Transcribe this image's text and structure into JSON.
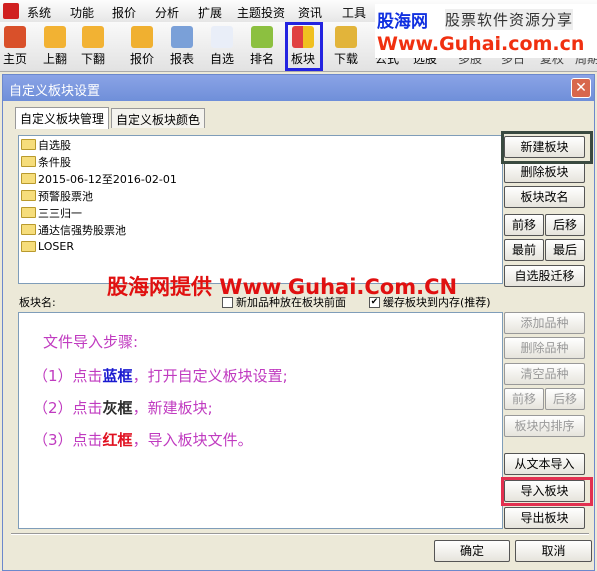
{
  "menubar": {
    "items": [
      "系统",
      "功能",
      "报价",
      "分析",
      "扩展",
      "主题投资",
      "资讯",
      "工具"
    ]
  },
  "toolbar": {
    "items": [
      {
        "label": "主页",
        "icon": "home-icon",
        "color": "#d9502a"
      },
      {
        "label": "上翻",
        "icon": "arrow-up-icon",
        "color": "#f2b233"
      },
      {
        "label": "下翻",
        "icon": "arrow-down-icon",
        "color": "#f2b233"
      },
      {
        "label": "报价",
        "icon": "yen-icon",
        "color": "#f0b030"
      },
      {
        "label": "报表",
        "icon": "report-icon",
        "color": "#7aa0d8"
      },
      {
        "label": "自选",
        "icon": "f6-icon",
        "color": "#e9eef8"
      },
      {
        "label": "排名",
        "icon": "rank-icon",
        "color": "#8cc040"
      },
      {
        "label": "板块",
        "icon": "blocks-icon",
        "color": "#e04040"
      },
      {
        "label": "下载",
        "icon": "download-icon",
        "color": "#e2b43a"
      },
      {
        "label": "公式",
        "icon": "",
        "color": ""
      },
      {
        "label": "选股",
        "icon": "",
        "color": ""
      },
      {
        "label": "多股",
        "icon": "",
        "color": ""
      },
      {
        "label": "多日",
        "icon": "",
        "color": ""
      },
      {
        "label": "复权",
        "icon": "",
        "color": ""
      },
      {
        "label": "周期",
        "icon": "",
        "color": ""
      }
    ]
  },
  "watermark_top": {
    "brand": "股海网",
    "tagline": "股票软件资源分享",
    "url": "Www.Guhai.com.cn"
  },
  "dialog": {
    "title": "自定义板块设置",
    "tabs": [
      "自定义板块管理",
      "自定义板块颜色"
    ],
    "blocks": [
      "自选股",
      "条件股",
      "2015-06-12至2016-02-01",
      "预警股票池",
      "三三归一",
      "通达信强势股票池",
      "LOSER"
    ],
    "block_buttons": {
      "new": "新建板块",
      "delete": "删除板块",
      "rename": "板块改名",
      "forward": "前移",
      "back": "后移",
      "first": "最前",
      "last": "最后",
      "migrate": "自选股迁移"
    },
    "watermark": "股海网提供 Www.Guhai.Com.CN",
    "block_name_label": "板块名:",
    "checkbox_front": {
      "label": "新加品种放在板块前面",
      "checked": false
    },
    "checkbox_cache": {
      "label": "缓存板块到内存(推荐)",
      "checked": true
    },
    "instructions": {
      "title": "文件导入步骤:",
      "steps": [
        {
          "prefix": "（1）点击",
          "key": "蓝框",
          "key_color": "#1a1ad0",
          "suffix": "，打开自定义板块设置;"
        },
        {
          "prefix": "（2）点击",
          "key": "灰框",
          "key_color": "#2a2a2a",
          "suffix": "，新建板块;"
        },
        {
          "prefix": "（3）点击",
          "key": "红框",
          "key_color": "#e01020",
          "suffix": "，导入板块文件。"
        }
      ]
    },
    "stock_buttons": {
      "add": "添加品种",
      "delete": "删除品种",
      "clear": "清空品种",
      "forward": "前移",
      "back": "后移",
      "sort": "板块内排序",
      "import_text": "从文本导入",
      "import_block": "导入板块",
      "export_block": "导出板块"
    },
    "ok": "确定",
    "cancel": "取消"
  }
}
